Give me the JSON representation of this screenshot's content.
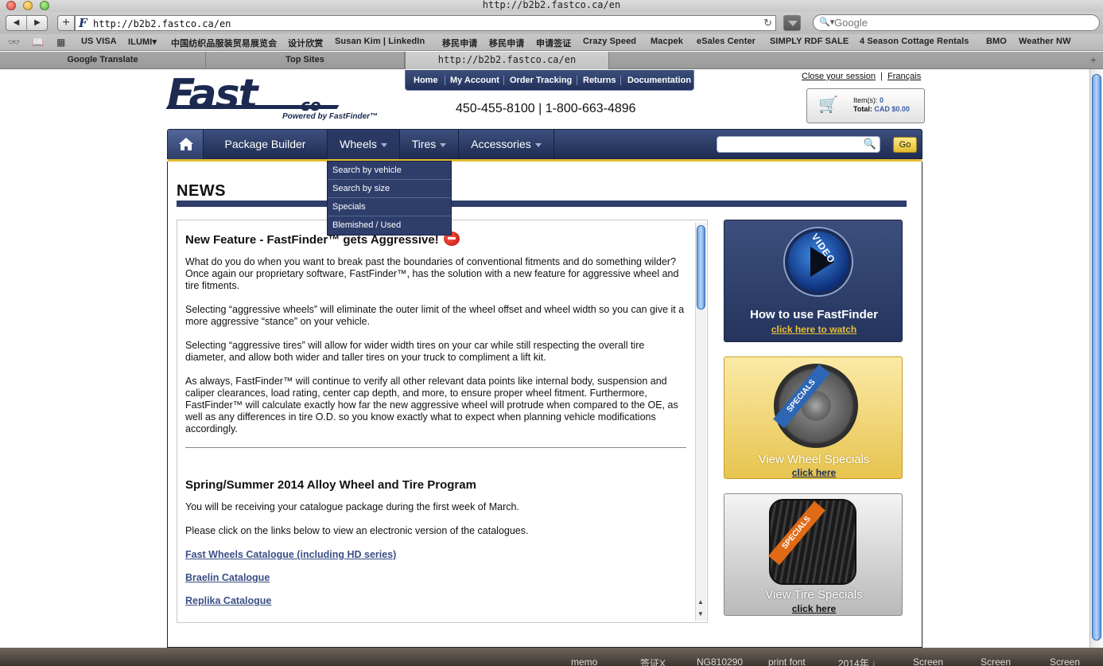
{
  "browser": {
    "window_title": "http://b2b2.fastco.ca/en",
    "url": "http://b2b2.fastco.ca/en",
    "search_placeholder": "Google",
    "bookmarks": [
      "US VISA",
      "ILUMI▾",
      "中国纺织品服装贸易展览会",
      "设计欣赏",
      "Susan Kim | LinkedIn",
      "移民申请",
      "移民申请",
      "申请签证",
      "Crazy Speed",
      "Macpek",
      "eSales Center",
      "SIMPLY RDF SALE",
      "4 Season Cottage Rentals",
      "BMO",
      "Weather NW"
    ],
    "tabs": [
      "Google Translate",
      "Top Sites",
      "http://b2b2.fastco.ca/en"
    ]
  },
  "header": {
    "logo_text": "Fast",
    "logo_sub": "co",
    "powered_by": "Powered by FastFinder™",
    "phone": "450-455-8100 | 1-800-663-4896",
    "close_session": "Close your session",
    "language": "Français",
    "top_nav": [
      "Home",
      "My Account",
      "Order Tracking",
      "Returns",
      "Documentation"
    ]
  },
  "cart": {
    "items_label": "Item(s):",
    "items_count": "0",
    "total_label": "Total:",
    "total_value": "CAD $0.00"
  },
  "main_nav": {
    "items": [
      "Package Builder",
      "Wheels",
      "Tires",
      "Accessories"
    ],
    "go_label": "Go",
    "wheels_dropdown": [
      "Search by vehicle",
      "Search by size",
      "Specials",
      "Blemished / Used"
    ]
  },
  "news": {
    "title": "NEWS",
    "article1": {
      "heading": "New Feature - FastFinder™ gets Aggressive!",
      "paragraphs": [
        "What do you do when you want to break past the boundaries of conventional fitments and do something wilder? Once again our proprietary software, FastFinder™, has the solution with a new feature for aggressive wheel and tire fitments.",
        "Selecting “aggressive wheels” will eliminate the outer limit of the wheel offset and wheel width so you can give it a more aggressive “stance” on your vehicle.",
        "Selecting “aggressive tires” will allow for wider width tires on your car while still respecting the overall tire diameter, and allow both wider and taller tires on your truck to compliment a lift kit.",
        "As always, FastFinder™ will continue to verify all other relevant data points like internal body, suspension and caliper clearances, load rating, center cap depth, and more, to ensure proper wheel fitment. Furthermore, FastFinder™ will calculate exactly how far the new aggressive wheel will protrude when compared to the OE, as well as any differences in tire O.D. so you know exactly what to expect when planning vehicle modifications accordingly."
      ]
    },
    "article2": {
      "heading": "Spring/Summer 2014 Alloy Wheel and Tire Program",
      "paragraphs": [
        "You will be receiving your catalogue package during the first week of March.",
        "Please click on the links below to view an electronic version of the catalogues."
      ],
      "links": [
        "Fast Wheels Catalogue (including HD series)",
        "Braelin Catalogue",
        "Replika Catalogue"
      ]
    }
  },
  "sidebar": {
    "video_badge": "VIDEO",
    "video_caption": "How to use FastFinder",
    "video_link": "click here to watch",
    "wheel_ribbon": "SPECIALS",
    "wheel_caption": "View Wheel Specials",
    "wheel_link": "click here",
    "tire_ribbon": "SPECIALS",
    "tire_caption": "View Tire Specials",
    "tire_link": "click here"
  },
  "dock": [
    "memo",
    "签证X",
    "NG810290",
    "print font",
    "2014年 ↓",
    "Screen",
    "Screen",
    "Screen"
  ],
  "colors": {
    "navy": "#2e3d6a",
    "gold": "#e3bb2e",
    "link": "#3b4f86"
  }
}
